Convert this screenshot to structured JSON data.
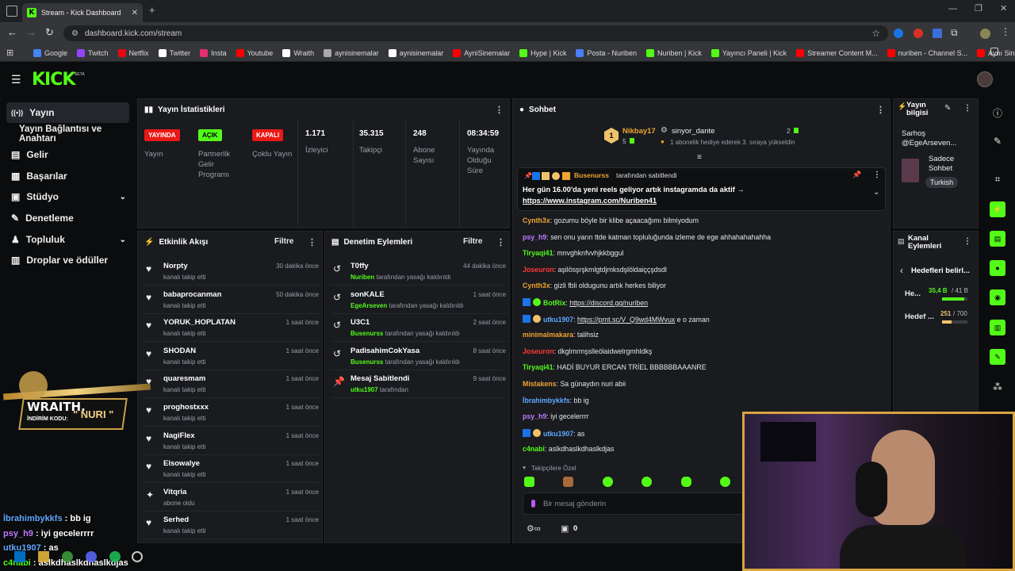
{
  "browser": {
    "tab_title": "Stream - Kick Dashboard",
    "url": "dashboard.kick.com/stream",
    "bookmarks": [
      {
        "label": "Google",
        "color": "#4285f4"
      },
      {
        "label": "Twitch",
        "color": "#9146ff"
      },
      {
        "label": "Netflix",
        "color": "#e50914"
      },
      {
        "label": "Twitter",
        "color": "#ffffff"
      },
      {
        "label": "Insta",
        "color": "#e1306c"
      },
      {
        "label": "Youtube",
        "color": "#ff0000"
      },
      {
        "label": "Wraith",
        "color": "#ffffff"
      },
      {
        "label": "aynisinemalar",
        "color": "#aaaaaa"
      },
      {
        "label": "aynisinemalar",
        "color": "#ffffff"
      },
      {
        "label": "AyniSinemalar",
        "color": "#ff0000"
      },
      {
        "label": "Hype | Kick",
        "color": "#53fc18"
      },
      {
        "label": "Posta - Nuriben",
        "color": "#4a7dff"
      },
      {
        "label": "Nuriben | Kick",
        "color": "#53fc18"
      },
      {
        "label": "Yayıncı Paneli | Kick",
        "color": "#53fc18"
      },
      {
        "label": "Streamer Content M...",
        "color": "#ff0000"
      },
      {
        "label": "nuriben - Channel S...",
        "color": "#ff0000"
      },
      {
        "label": "Aynı Sinemalar - Ça...",
        "color": "#ff0000"
      }
    ]
  },
  "app": {
    "logo": "KICK",
    "beta": "BETA"
  },
  "sidebar": {
    "items": [
      {
        "label": "Yayın",
        "icon": "broadcast-icon"
      },
      {
        "label": "Yayın Bağlantısı ve Anahtarı",
        "icon": ""
      },
      {
        "label": "Gelir",
        "icon": "revenue-icon"
      },
      {
        "label": "Başarılar",
        "icon": "achievements-icon"
      },
      {
        "label": "Stüdyo",
        "icon": "studio-icon"
      },
      {
        "label": "Denetleme",
        "icon": "moderation-icon"
      },
      {
        "label": "Topluluk",
        "icon": "community-icon"
      },
      {
        "label": "Droplar ve ödüller",
        "icon": "drops-icon"
      }
    ]
  },
  "stats": {
    "title": "Yayın İstatistikleri",
    "badges": [
      {
        "badge": "YAYINDA",
        "label": "Yayın",
        "color": "#e91916"
      },
      {
        "badge": "AÇIK",
        "label": "Partnerlik Gelir Programı",
        "color": "#53fc18"
      },
      {
        "badge": "KAPALI",
        "label": "Çoklu Yayın",
        "color": "#e91916"
      }
    ],
    "values": [
      {
        "value": "1.171",
        "label": "İzleyici"
      },
      {
        "value": "35.315",
        "label": "Takipçi"
      },
      {
        "value": "248",
        "label": "Abone Sayısı"
      },
      {
        "value": "08:34:59",
        "label": "Yayında Olduğu Süre"
      }
    ]
  },
  "activity": {
    "title": "Etkinlik Akışı",
    "filter": "Filtre",
    "events": [
      {
        "name": "Norpty",
        "sub": "kanalı takip etti",
        "time": "30 dakika önce",
        "icon": "heart-icon"
      },
      {
        "name": "babaprocanman",
        "sub": "kanalı takip etti",
        "time": "50 dakika önce",
        "icon": "heart-icon"
      },
      {
        "name": "YORUK_HOPLATAN",
        "sub": "kanalı takip etti",
        "time": "1 saat önce",
        "icon": "heart-icon"
      },
      {
        "name": "SHODAN",
        "sub": "kanalı takip etti",
        "time": "1 saat önce",
        "icon": "heart-icon"
      },
      {
        "name": "quaresmam",
        "sub": "kanalı takip etti",
        "time": "1 saat önce",
        "icon": "heart-icon"
      },
      {
        "name": "proghostxxx",
        "sub": "kanalı takip etti",
        "time": "1 saat önce",
        "icon": "heart-icon"
      },
      {
        "name": "NagiFlex",
        "sub": "kanalı takip etti",
        "time": "1 saat önce",
        "icon": "heart-icon"
      },
      {
        "name": "Elsowalye",
        "sub": "kanalı takip etti",
        "time": "1 saat önce",
        "icon": "heart-icon"
      },
      {
        "name": "Vitqria",
        "sub": "abone oldu",
        "time": "1 saat önce",
        "icon": "sparkle-icon"
      },
      {
        "name": "Serhed",
        "sub": "kanalı takip etti",
        "time": "1 saat önce",
        "icon": "heart-icon"
      }
    ]
  },
  "modactions": {
    "title": "Denetim Eylemleri",
    "filter": "Filtre",
    "events": [
      {
        "name": "T0ffy",
        "mod": "Nuriben",
        "sub": "tarafından yasağı kaldırıldı",
        "time": "44 dakika önce",
        "icon": "undo-icon"
      },
      {
        "name": "sonKALE",
        "mod": "EgeArseven",
        "sub": "tarafından yasağı kaldırıldı",
        "time": "1 saat önce",
        "icon": "undo-icon"
      },
      {
        "name": "U3C1",
        "mod": "Busenurss",
        "sub": "tarafından yasağı kaldırıldı",
        "time": "2 saat önce",
        "icon": "undo-icon"
      },
      {
        "name": "PadisahimCokYasa",
        "mod": "Busenurss",
        "sub": "tarafından yasağı kaldırıldı",
        "time": "8 saat önce",
        "icon": "undo-icon"
      },
      {
        "name": "Mesaj Sabitlendi",
        "mod": "utku1907",
        "sub": "tarafından",
        "time": "9 saat önce",
        "icon": "pin-icon"
      }
    ]
  },
  "chat": {
    "title": "Sohbet",
    "gift": {
      "user": "Nikbay17",
      "count": "5",
      "target": "sinyor_dante",
      "target_count": "2",
      "message": "1 abonelik hediye ederek 3. sıraya yükseldin"
    },
    "pinned": {
      "by": "Busenurss",
      "by_suffix": "tarafından sabitlendi",
      "text": "Her gün 16.00'da yeni reels geliyor artık instagramda da aktif →",
      "link": "https://www.instagram.com/Nuriben41"
    },
    "messages": [
      {
        "user": "Cynth3x",
        "color": "#f0a530",
        "text": "gozumu böyle bir klibe açaacağımı bilmiyodum"
      },
      {
        "user": "psy_h9",
        "color": "#c27bff",
        "text": "sen onu yarın ttde katman topluluğunda izleme de ege ahhahahahahha"
      },
      {
        "user": "Tiryaqi41",
        "color": "#53fc18",
        "text": "mnvghknfvvhjkkbggul"
      },
      {
        "user": "Joseuron",
        "color": "#ff3838",
        "text": "aşilösşrşkmlgtdjmksdşlöldaiççşdsdl"
      },
      {
        "user": "Cynth3x",
        "color": "#f0a530",
        "text": "gizli fbli oldugunu artık herkes biliyor"
      },
      {
        "user": "BotRix",
        "color": "#53fc18",
        "text": "https://discord.gg/nuriben"
      },
      {
        "user": "utku1907",
        "color": "#5fa8ff",
        "text": "https://prnt.sc/V_Q9wd4MWvux",
        "extra": " e o zaman"
      },
      {
        "user": "minimalmakara",
        "color": "#f0a530",
        "text": "talihsiz"
      },
      {
        "user": "Joseuron",
        "color": "#ff3838",
        "text": "dkglmrmşslleölaidwelrgmhldkş"
      },
      {
        "user": "Tiryaqi41",
        "color": "#53fc18",
        "text": "HADİ BUYUR ERCAN TRİEL BBBBBBAAANRE"
      },
      {
        "user": "Mistakens",
        "color": "#f0a530",
        "text": "Sa günaydın nuri abii"
      },
      {
        "user": "İbrahimbykkfs",
        "color": "#5fa8ff",
        "text": "bb ig"
      },
      {
        "user": "psy_h9",
        "color": "#c27bff",
        "text": "iyi gecelerrrr"
      },
      {
        "user": "utku1907",
        "color": "#5fa8ff",
        "text": "as"
      },
      {
        "user": "c4nabi",
        "color": "#53fc18",
        "text": "aslkdhaslkdhaslkdjas"
      }
    ],
    "followers_only": "Takipçilere Özel",
    "input_placeholder": "Bir mesaj gönderin",
    "points": "0"
  },
  "streaminfo": {
    "title": "Yayın bilgisi",
    "stream_title": "Sarhoş @EgeArseven...",
    "category": "Sadece Sohbet",
    "language": "Turkish"
  },
  "goals": {
    "title": "Kanal Eylemleri",
    "back_label": "Hedefleri belirl...",
    "items": [
      {
        "label": "He...",
        "value": "35,4 B",
        "total": "/ 41 B",
        "progress": 0.86,
        "color": "#53fc18"
      },
      {
        "label": "Hedef ...",
        "value": "251",
        "total": "/ 700",
        "progress": 0.36,
        "color": "#f0c36a"
      }
    ]
  },
  "overlay": {
    "brand": "WRAITH.",
    "code_label": "İNDİRİM KODU:",
    "code": "\" NURI \"",
    "chat": [
      {
        "user": "İbrahimbykkfs",
        "color": "#5fa8ff",
        "text": "bb ig"
      },
      {
        "user": "psy_h9",
        "color": "#c27bff",
        "text": "iyi gecelerrrr"
      },
      {
        "user": "utku1907",
        "color": "#5fa8ff",
        "text": "as"
      },
      {
        "user": "c4nabi",
        "color": "#53fc18",
        "text": "aslkdhaslkdhaslkdjas"
      }
    ]
  }
}
